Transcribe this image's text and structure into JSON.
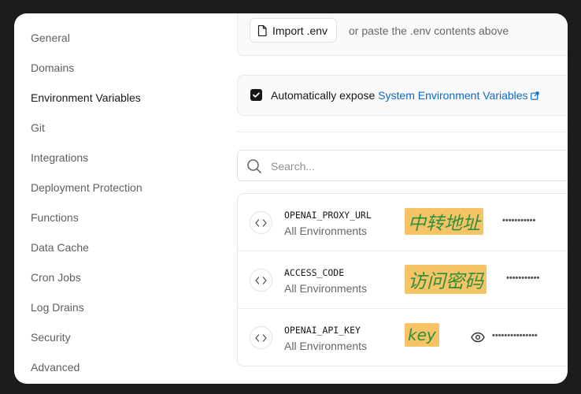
{
  "sidebar": {
    "items": [
      {
        "label": "General",
        "active": false
      },
      {
        "label": "Domains",
        "active": false
      },
      {
        "label": "Environment Variables",
        "active": true
      },
      {
        "label": "Git",
        "active": false
      },
      {
        "label": "Integrations",
        "active": false
      },
      {
        "label": "Deployment Protection",
        "active": false
      },
      {
        "label": "Functions",
        "active": false
      },
      {
        "label": "Data Cache",
        "active": false
      },
      {
        "label": "Cron Jobs",
        "active": false
      },
      {
        "label": "Log Drains",
        "active": false
      },
      {
        "label": "Security",
        "active": false
      },
      {
        "label": "Advanced",
        "active": false
      }
    ]
  },
  "import": {
    "button_label": "Import .env",
    "hint": "or paste the .env contents above"
  },
  "expose": {
    "checked": true,
    "text": "Automatically expose",
    "link": "System Environment Variables"
  },
  "search": {
    "placeholder": "Search..."
  },
  "variables": [
    {
      "name": "OPENAI_PROXY_URL",
      "env": "All Environments",
      "annotation": "中转地址",
      "masked": "•••••••••••"
    },
    {
      "name": "ACCESS_CODE",
      "env": "All Environments",
      "annotation": "访问密码",
      "masked": "•••••••••••"
    },
    {
      "name": "OPENAI_API_KEY",
      "env": "All Environments",
      "annotation": "key",
      "masked": "•••••••••••••••"
    }
  ],
  "colors": {
    "link": "#0b69c7",
    "annotation_bg": "#f6c466",
    "annotation_text": "#2f8f3a"
  }
}
